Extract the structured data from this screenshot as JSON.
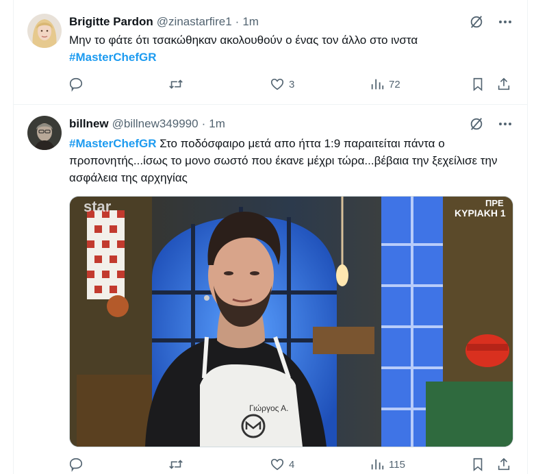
{
  "tweets": [
    {
      "name": "Brigitte Pardon",
      "handle": "@zinastarfire1",
      "separator": "·",
      "time": "1m",
      "text": "Μην το φάτε ότι τσακώθηκαν ακολουθούν ο ένας τον άλλο στο ινστα",
      "hashtag": "#MasterChefGR",
      "likes": "3",
      "views": "72"
    },
    {
      "name": "billnew",
      "handle": "@billnew349990",
      "separator": "·",
      "time": "1m",
      "hashtag": "#MasterChefGR",
      "text": "Στο ποδόσφαιρο μετά απο ήττα 1:9 παραιτείται πάντα ο προπονητής...ίσως το μονο σωστό που έκανε μέχρι τώρα...βέβαια την ξεχείλισε την ασφάλεια της αρχηγίας",
      "likes": "4",
      "views": "115",
      "media": {
        "channel_logo": "star",
        "broadcast_text": "ΚΥΡΙΑΚΗ 1",
        "broadcast_text_partial": "ΠΡΕ",
        "apron_name": "Γιώργος Α."
      }
    }
  ],
  "colors": {
    "accent": "#1d9bf0",
    "muted": "#536471",
    "text": "#0f1419"
  }
}
